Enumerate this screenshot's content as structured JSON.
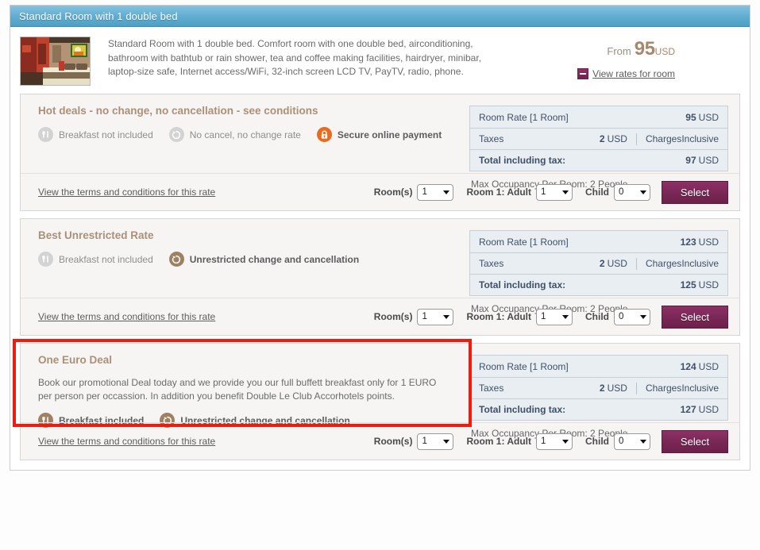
{
  "room": {
    "header_title": "Standard Room with 1 double bed",
    "description": "Standard Room with 1 double bed. Comfort room with one double bed, airconditioning, bathroom with bathtub or rain shower, tea and coffee making facilities, hairdryer, minibar, laptop-size safe, Internet access/WiFi, 32-inch screen LCD TV, PayTV, radio, phone.",
    "from_label": "From",
    "from_amount": "95",
    "from_currency": "USD",
    "view_rates_label": "View rates for room",
    "thumb_alt": "hotel-room-photo"
  },
  "labels": {
    "terms_link": "View the terms and conditions for this rate",
    "rooms": "Room(s)",
    "adult": "Room 1: Adult",
    "child": "Child",
    "select": "Select",
    "room_rate": "Room Rate [1 Room]",
    "taxes": "Taxes",
    "charges": "Charges",
    "total": "Total including tax:",
    "max_occupancy": "Max Occupancy Per Room: 2 People",
    "currency": "USD",
    "inclusive": "Inclusive"
  },
  "colors": {
    "header_blue": "#63aed2",
    "accent_brown": "#ab9078",
    "select_purple": "#7b2857",
    "highlight_red": "#ee1b11",
    "price_table_bg": "#e9eef3",
    "icon_orange": "#ea6a1e",
    "icon_gray": "#d3d3d3",
    "icon_brown": "#9e8163"
  },
  "rates": [
    {
      "title": "Hot deals - no change, no cancellation - see conditions",
      "promo_text": "",
      "amenities": [
        {
          "icon": "cutlery-icon",
          "style": "gray",
          "label": "Breakfast not included",
          "emphasis": "muted"
        },
        {
          "icon": "no-cancel-icon",
          "style": "gray",
          "label": "No cancel, no change rate",
          "emphasis": "muted"
        },
        {
          "icon": "lock-icon",
          "style": "orange",
          "label": "Secure online payment",
          "emphasis": "strong"
        }
      ],
      "price": {
        "room_rate_value": "95",
        "taxes_value": "2",
        "charges_value": "Inclusive",
        "total_value": "97"
      },
      "controls": {
        "rooms": "1",
        "adult": "1",
        "child": "0"
      },
      "highlighted": false
    },
    {
      "title": "Best Unrestricted Rate",
      "promo_text": "",
      "amenities": [
        {
          "icon": "cutlery-icon",
          "style": "gray",
          "label": "Breakfast not included",
          "emphasis": "muted"
        },
        {
          "icon": "refresh-icon",
          "style": "brown",
          "label": "Unrestricted change and cancellation",
          "emphasis": "strong"
        }
      ],
      "price": {
        "room_rate_value": "123",
        "taxes_value": "2",
        "charges_value": "Inclusive",
        "total_value": "125"
      },
      "controls": {
        "rooms": "1",
        "adult": "1",
        "child": "0"
      },
      "highlighted": false
    },
    {
      "title": "One Euro Deal",
      "promo_text": "Book our promotional Deal today and we provide you our full buffett breakfast only for 1 EURO per person per occassion. In addition you benefit Double Le Club Accorhotels points.",
      "amenities": [
        {
          "icon": "cutlery-icon",
          "style": "brown",
          "label": "Breakfast included",
          "emphasis": "strong"
        },
        {
          "icon": "refresh-icon",
          "style": "brown",
          "label": "Unrestricted change and cancellation",
          "emphasis": "strong"
        }
      ],
      "price": {
        "room_rate_value": "124",
        "taxes_value": "2",
        "charges_value": "Inclusive",
        "total_value": "127"
      },
      "controls": {
        "rooms": "1",
        "adult": "1",
        "child": "0"
      },
      "highlighted": true
    }
  ]
}
